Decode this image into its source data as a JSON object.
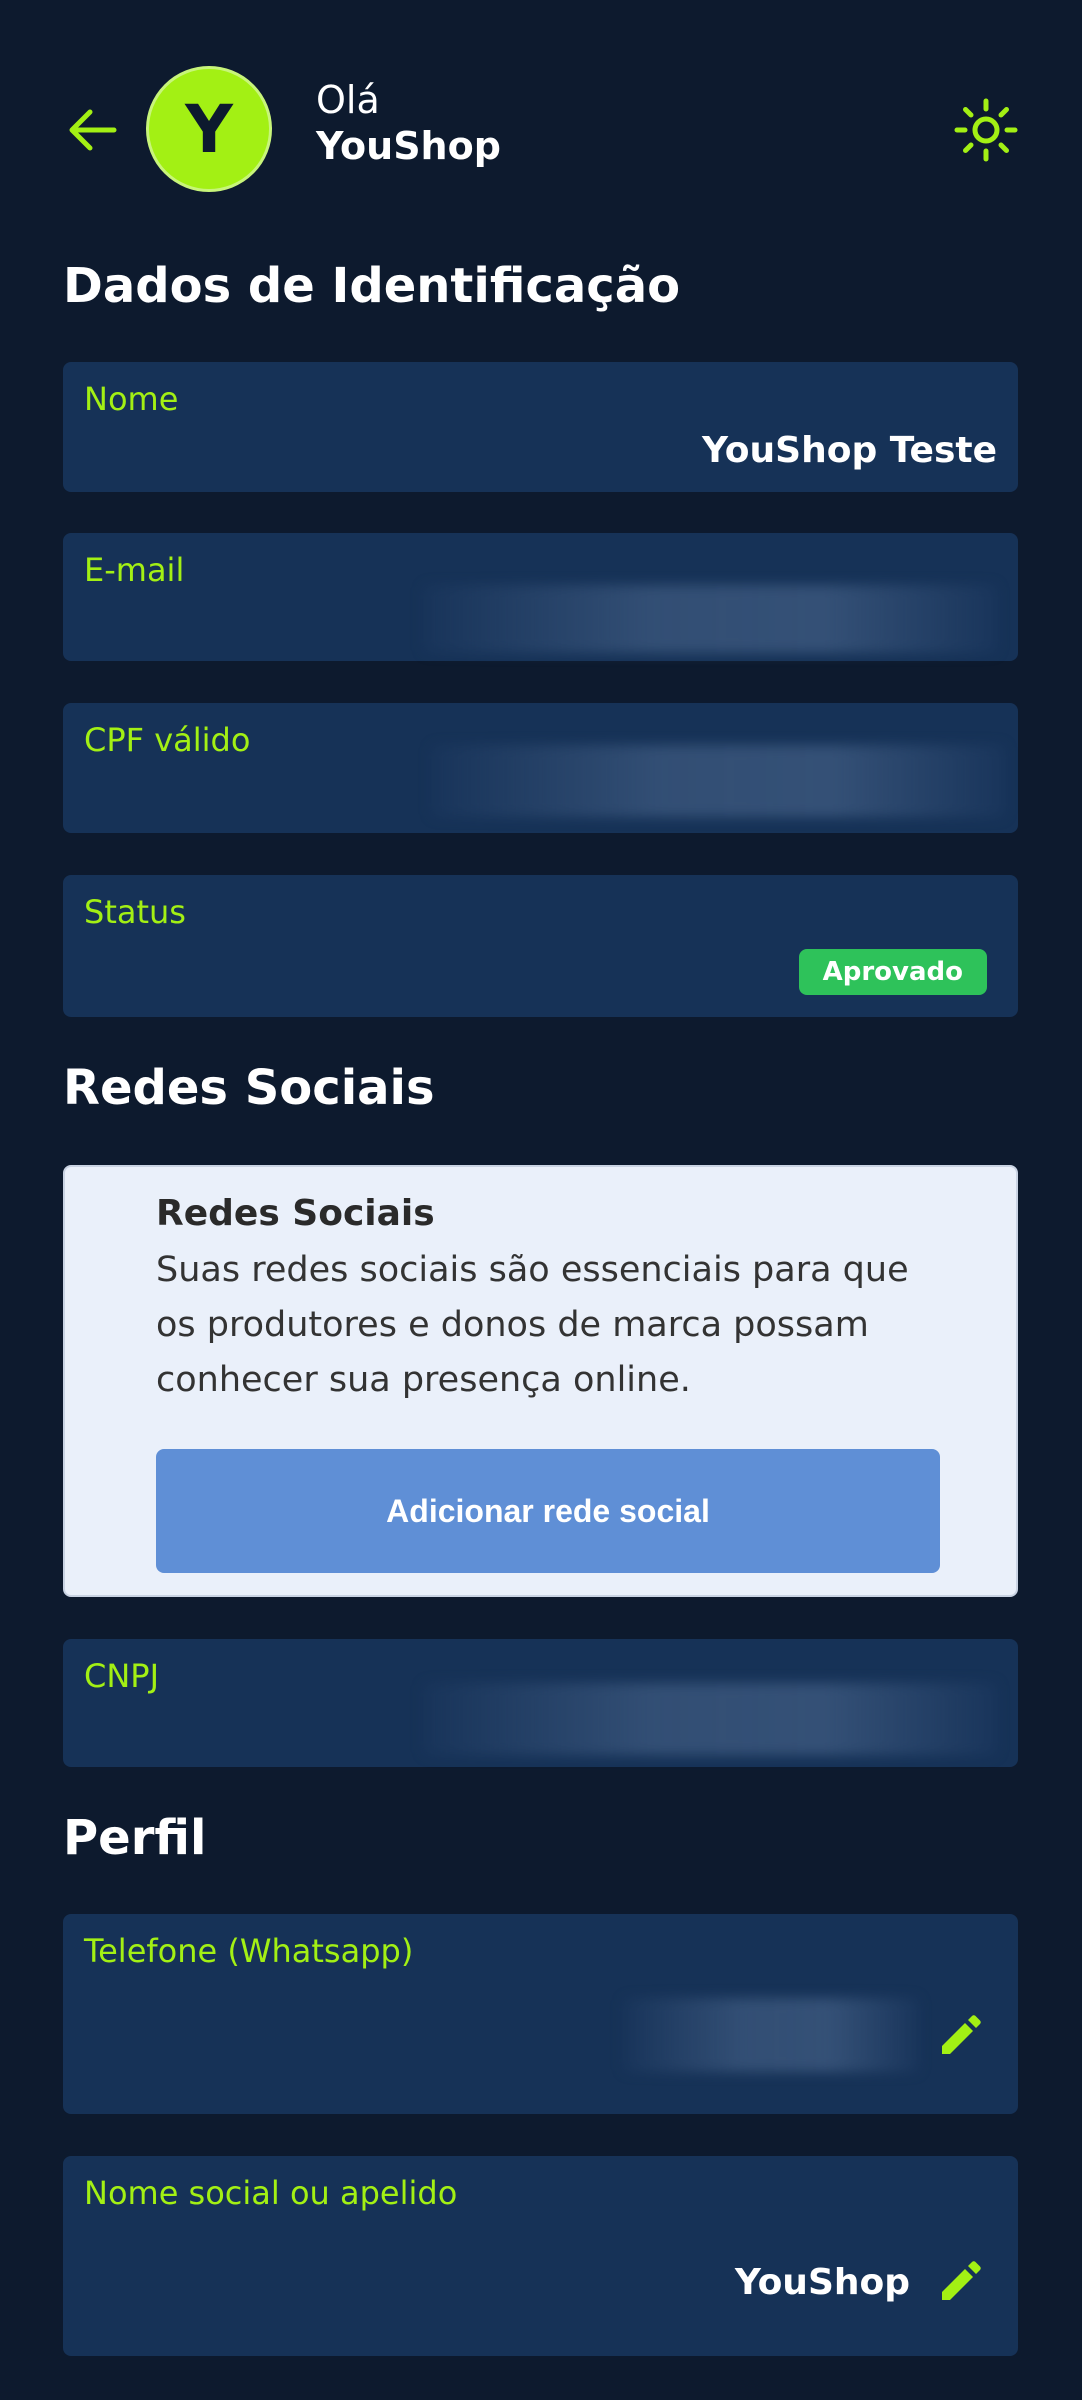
{
  "header": {
    "avatar_letter": "Y",
    "greeting": "Olá",
    "user_name": "YouShop"
  },
  "sections": {
    "identification": "Dados de Identificação",
    "social": "Redes Sociais",
    "profile": "Perfil"
  },
  "fields": {
    "name": {
      "label": "Nome",
      "value": "YouShop Teste"
    },
    "email": {
      "label": "E-mail"
    },
    "cpf": {
      "label": "CPF válido"
    },
    "status": {
      "label": "Status",
      "badge": "Aprovado"
    },
    "cnpj": {
      "label": "CNPJ"
    },
    "phone": {
      "label": "Telefone (Whatsapp)"
    },
    "nickname": {
      "label": "Nome social ou apelido",
      "value": "YouShop"
    }
  },
  "social_card": {
    "title": "Redes Sociais",
    "description": "Suas redes sociais são essenciais para que os produtores e donos de marca possam conhecer sua presença online.",
    "button": "Adicionar rede social"
  },
  "colors": {
    "background": "#0d1a2e",
    "card": "#163257",
    "accent": "#a3f014",
    "badge": "#2ec25a",
    "button": "#5f8fd6"
  },
  "icons": {
    "back": "arrow-left-icon",
    "theme": "sun-icon",
    "edit": "pencil-icon"
  }
}
